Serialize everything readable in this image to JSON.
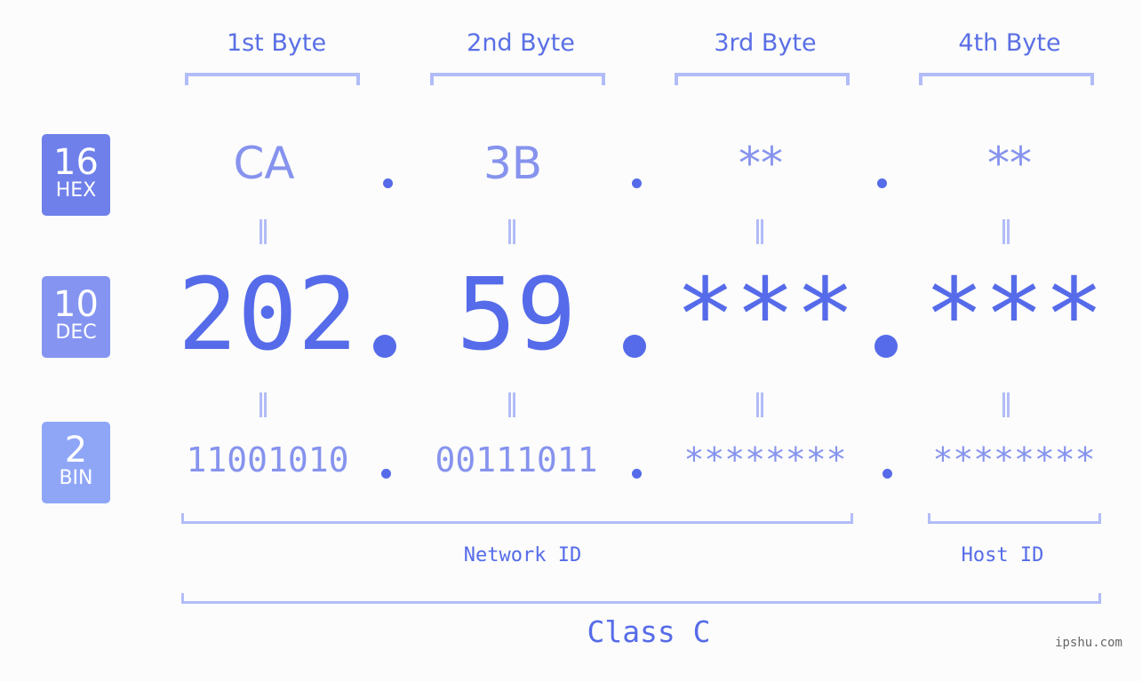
{
  "bytes": [
    {
      "header": "1st Byte",
      "hex": "CA",
      "dec": "202",
      "bin": "11001010"
    },
    {
      "header": "2nd Byte",
      "hex": "3B",
      "dec": "59",
      "bin": "00111011"
    },
    {
      "header": "3rd Byte",
      "hex": "**",
      "dec": "***",
      "bin": "********"
    },
    {
      "header": "4th Byte",
      "hex": "**",
      "dec": "***",
      "bin": "********"
    }
  ],
  "badges": {
    "hex": {
      "num": "16",
      "label": "HEX",
      "color": "#6f80ea"
    },
    "dec": {
      "num": "10",
      "label": "DEC",
      "color": "#8494f0"
    },
    "bin": {
      "num": "2",
      "label": "BIN",
      "color": "#8fa6f7"
    }
  },
  "network_label": "Network ID",
  "host_label": "Host ID",
  "class_label": "Class C",
  "watermark": "ipshu.com",
  "colors": {
    "accent": "#566be9",
    "light": "#8693ee",
    "bracket": "#b2bcf8"
  }
}
